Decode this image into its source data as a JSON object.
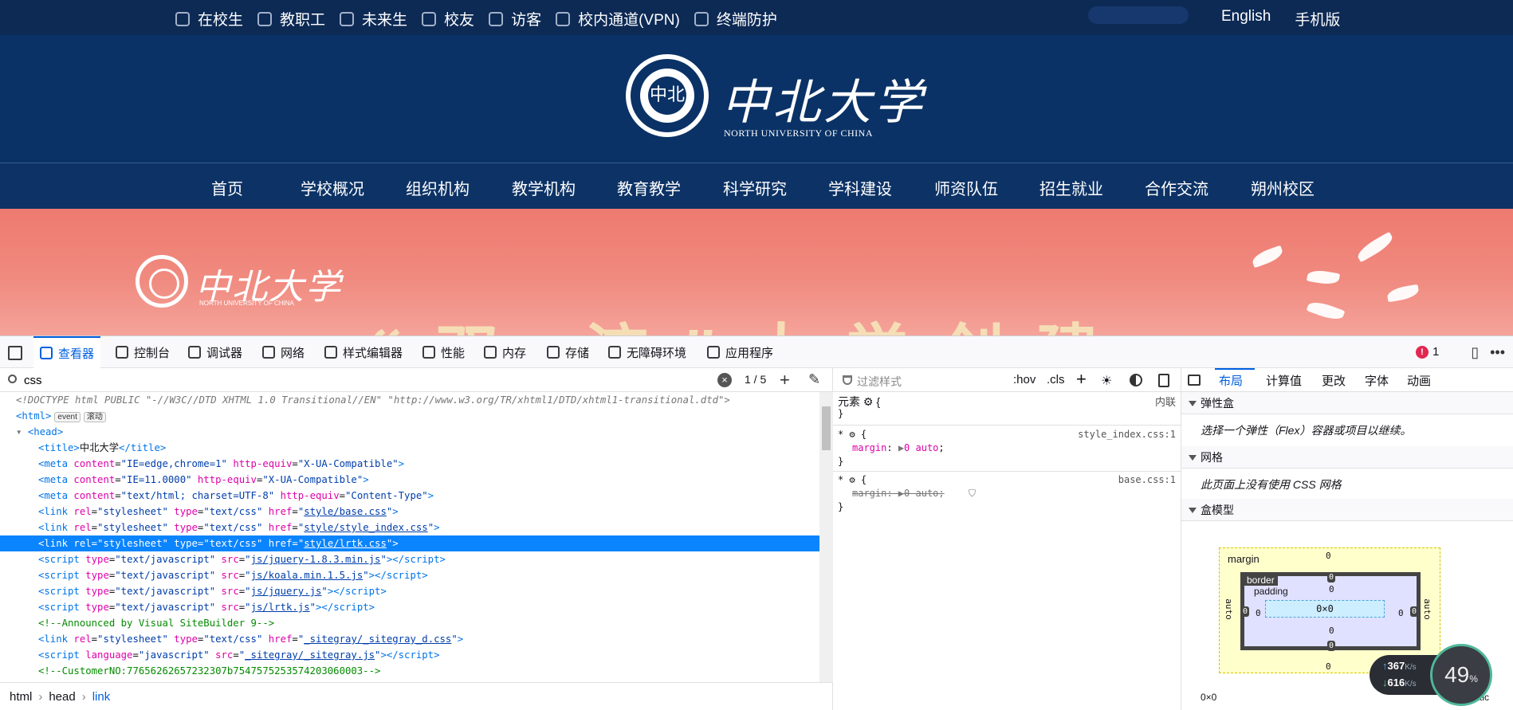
{
  "site": {
    "top_links": [
      {
        "label": "在校生",
        "icon": "student-icon"
      },
      {
        "label": "教职工",
        "icon": "staff-icon"
      },
      {
        "label": "未来生",
        "icon": "future-student-icon"
      },
      {
        "label": "校友",
        "icon": "alumni-icon"
      },
      {
        "label": "访客",
        "icon": "visitor-icon"
      },
      {
        "label": "校内通道(VPN)",
        "icon": "vpn-icon"
      },
      {
        "label": "终端防护",
        "icon": "shield-icon"
      }
    ],
    "lang_english": "English",
    "mobile": "手机版",
    "logo_text": "中北大学",
    "logo_sub": "NORTH UNIVERSITY OF CHINA",
    "seal_text": "中北",
    "nav": [
      "首页",
      "学校概况",
      "组织机构",
      "教学机构",
      "教育教学",
      "科学研究",
      "学科建设",
      "师资队伍",
      "招生就业",
      "合作交流",
      "朔州校区"
    ],
    "banner_logo_text": "中北大学",
    "banner_logo_sub": "NORTH UNIVERSITY OF CHINA",
    "banner_big_text": "“双 流”大学创建"
  },
  "devtools": {
    "tabs": [
      {
        "label": "查看器",
        "icon": "inspector-icon"
      },
      {
        "label": "控制台",
        "icon": "console-icon"
      },
      {
        "label": "调试器",
        "icon": "debugger-icon"
      },
      {
        "label": "网络",
        "icon": "network-icon"
      },
      {
        "label": "样式编辑器",
        "icon": "style-editor-icon"
      },
      {
        "label": "性能",
        "icon": "performance-icon"
      },
      {
        "label": "内存",
        "icon": "memory-icon"
      },
      {
        "label": "存储",
        "icon": "storage-icon"
      },
      {
        "label": "无障碍环境",
        "icon": "accessibility-icon"
      },
      {
        "label": "应用程序",
        "icon": "application-icon"
      }
    ],
    "error_count": "1",
    "search_value": "css",
    "match_count": "1 / 5",
    "breadcrumbs": [
      "html",
      "head",
      "link"
    ],
    "rules": {
      "filter_placeholder": "过滤样式",
      "hov": ":hov",
      "cls": ".cls",
      "element_label": "元素",
      "inline": "内联",
      "rule1_src": "style_index.css:1",
      "rule2_src": "base.css:1",
      "margin_prop": "margin",
      "margin_val": "0 auto"
    },
    "layout": {
      "tabs": [
        "布局",
        "计算值",
        "更改",
        "字体",
        "动画"
      ],
      "flex_title": "弹性盒",
      "flex_body": "选择一个弹性（Flex）容器或项目以继续。",
      "grid_title": "网格",
      "grid_body": "此页面上没有使用 CSS 网格",
      "box_title": "盒模型",
      "margin_label": "margin",
      "border_label": "border",
      "padding_label": "padding",
      "content_size": "0×0",
      "zero": "0",
      "auto": "auto",
      "foot_size": "0×0",
      "position": "static"
    }
  },
  "net_widget": {
    "up": "367",
    "down": "616",
    "unit": "K/s",
    "percent": "49",
    "percent_sign": "%"
  }
}
